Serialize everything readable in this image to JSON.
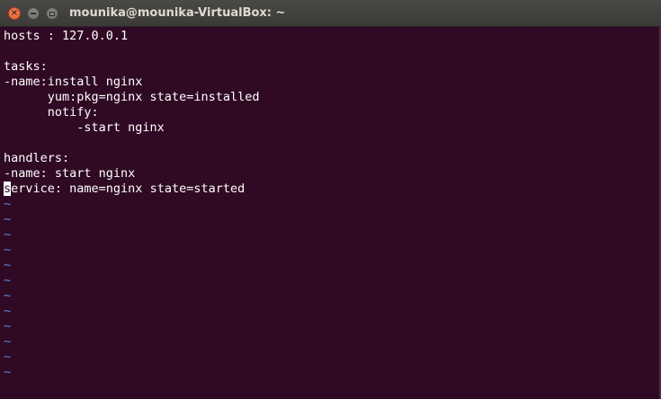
{
  "window": {
    "title": "mounika@mounika-VirtualBox: ~",
    "close_glyph": "×",
    "minimize_glyph": "−",
    "maximize_glyph": "□"
  },
  "colors": {
    "terminal_background": "#300a24",
    "text": "#ffffff",
    "tilde": "#5a88d8",
    "close_button": "#e25a2a"
  },
  "editor": {
    "lines": [
      "hosts : 127.0.0.1",
      "",
      "tasks:",
      "-name:install nginx",
      "      yum:pkg=nginx state=installed",
      "      notify:",
      "          -start nginx",
      "",
      "handlers:",
      "-name: start nginx"
    ],
    "cursor_line": {
      "cursor_char": "s",
      "rest": "ervice: name=nginx state=started"
    },
    "empty_line_marker": "~",
    "empty_line_count": 12
  }
}
